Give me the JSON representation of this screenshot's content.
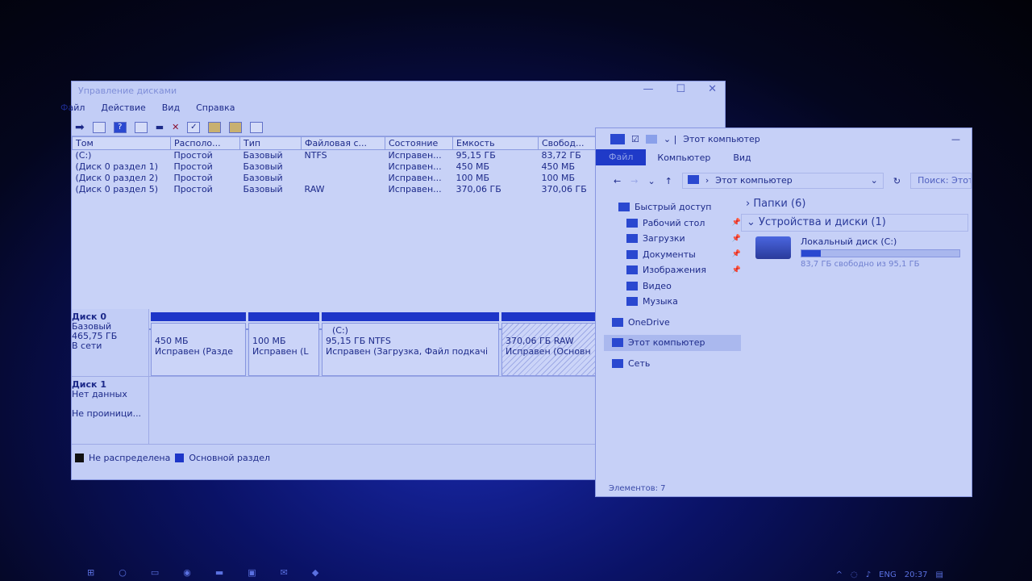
{
  "disk_mgmt": {
    "title": "Управление дисками",
    "menu": [
      "Файл",
      "Действие",
      "Вид",
      "Справка"
    ],
    "columns": [
      "Том",
      "Располо...",
      "Тип",
      "Файловая с...",
      "Состояние",
      "Емкость",
      "Свобод..."
    ],
    "rows": [
      [
        "(C:)",
        "Простой",
        "Базовый",
        "NTFS",
        "Исправен...",
        "95,15 ГБ",
        "83,72 ГБ"
      ],
      [
        "(Диск 0 раздел 1)",
        "Простой",
        "Базовый",
        "",
        "Исправен...",
        "450 МБ",
        "450 МБ"
      ],
      [
        "(Диск 0 раздел 2)",
        "Простой",
        "Базовый",
        "",
        "Исправен...",
        "100 МБ",
        "100 МБ"
      ],
      [
        "(Диск 0 раздел 5)",
        "Простой",
        "Базовый",
        "RAW",
        "Исправен...",
        "370,06 ГБ",
        "370,06 ГБ"
      ]
    ],
    "disk0": {
      "name": "Диск 0",
      "type": "Базовый",
      "size": "465,75 ГБ",
      "state": "В сети",
      "partitions": [
        {
          "label": "",
          "size": "450 МБ",
          "status": "Исправен (Разде"
        },
        {
          "label": "",
          "size": "100 МБ",
          "status": "Исправен (L"
        },
        {
          "label": "(C:)",
          "size": "95,15 ГБ NTFS",
          "status": "Исправен (Загрузка, Файл подкачі"
        },
        {
          "label": "",
          "size": "370,06 ГБ RAW",
          "status": "Исправен (Основн"
        }
      ]
    },
    "disk1": {
      "name": "Диск 1",
      "type": "Нет данных",
      "state": "Не проиници..."
    },
    "legend": [
      {
        "label": "Не распределена",
        "color": "#111111"
      },
      {
        "label": "Основной раздел",
        "color": "#1e36c8"
      }
    ]
  },
  "explorer": {
    "title": "Этот компьютер",
    "ribbon": [
      "Файл",
      "Компьютер",
      "Вид"
    ],
    "address": "Этот компьютер",
    "search_placeholder": "Поиск: Этот к",
    "nav": [
      {
        "label": "Быстрый доступ",
        "pinned": false
      },
      {
        "label": "Рабочий стол",
        "pinned": true
      },
      {
        "label": "Загрузки",
        "pinned": true
      },
      {
        "label": "Документы",
        "pinned": true
      },
      {
        "label": "Изображения",
        "pinned": true
      },
      {
        "label": "Видео",
        "pinned": false
      },
      {
        "label": "Музыка",
        "pinned": false
      },
      {
        "label": "OneDrive",
        "pinned": false
      },
      {
        "label": "Этот компьютер",
        "pinned": false
      },
      {
        "label": "Сеть",
        "pinned": false
      }
    ],
    "folders_section": "Папки (6)",
    "devices_section": "Устройства и диски (1)",
    "drive": {
      "name": "Локальный диск (C:)",
      "free_text": "83,7 ГБ свободно из 95,1 ГБ",
      "used_fraction": 0.12
    },
    "status": "Элементов: 7"
  },
  "taskbar": {
    "lang": "ENG",
    "time": "20:37"
  }
}
